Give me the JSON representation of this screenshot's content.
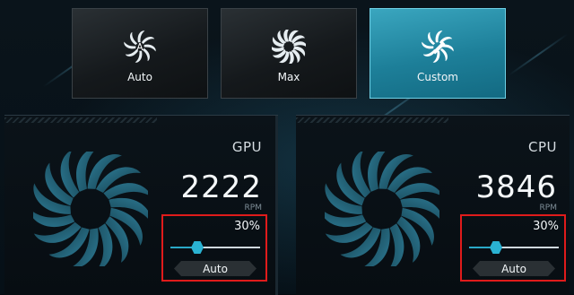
{
  "modes": [
    {
      "label": "Auto",
      "icon": "fan-auto-icon",
      "active": false
    },
    {
      "label": "Max",
      "icon": "fan-max-icon",
      "active": false
    },
    {
      "label": "Custom",
      "icon": "fan-custom-icon",
      "active": true
    }
  ],
  "gpu": {
    "title": "GPU",
    "rpm": "2222",
    "unit": "RPM",
    "percent_label": "30%",
    "level": 0.3,
    "button": "Auto"
  },
  "cpu": {
    "title": "CPU",
    "rpm": "3846",
    "unit": "RPM",
    "percent_label": "30%",
    "level": 0.3,
    "button": "Auto"
  },
  "colors": {
    "accent": "#2ab2d2",
    "active_card": "#1d7f99",
    "highlight_box": "#e01b1b"
  }
}
